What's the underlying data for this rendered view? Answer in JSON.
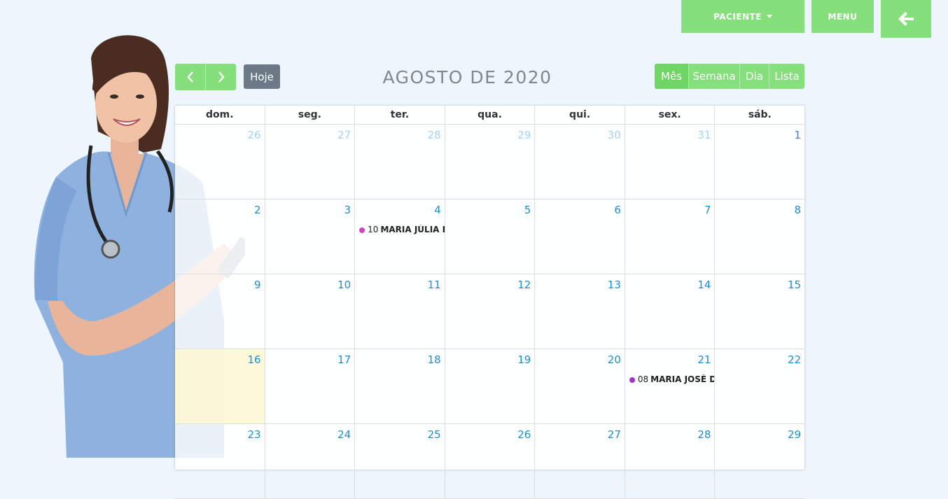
{
  "nav": {
    "paciente_label": "PACIENTE",
    "menu_label": "MENU"
  },
  "toolbar": {
    "today_label": "Hoje",
    "title": "AGOSTO DE 2020",
    "views": [
      "Mês",
      "Semana",
      "Dia",
      "Lista"
    ],
    "active_view": "Mês"
  },
  "colors": {
    "accent": "#85e07c",
    "today_button": "#6c7a88",
    "day_number": "#1f8fd6",
    "today_highlight": "#fcf8d2"
  },
  "calendar": {
    "weekdays": [
      "dom.",
      "seg.",
      "ter.",
      "qua.",
      "qui.",
      "sex.",
      "sáb."
    ],
    "weeks": [
      [
        {
          "d": "26",
          "other": true
        },
        {
          "d": "27",
          "other": true
        },
        {
          "d": "28",
          "other": true
        },
        {
          "d": "29",
          "other": true
        },
        {
          "d": "30",
          "other": true
        },
        {
          "d": "31",
          "other": true
        },
        {
          "d": "1"
        }
      ],
      [
        {
          "d": "2"
        },
        {
          "d": "3"
        },
        {
          "d": "4",
          "event": {
            "time": "10",
            "title": "MARIA JÚLIA D",
            "color": "#d63fc6"
          }
        },
        {
          "d": "5"
        },
        {
          "d": "6"
        },
        {
          "d": "7"
        },
        {
          "d": "8"
        }
      ],
      [
        {
          "d": "9"
        },
        {
          "d": "10"
        },
        {
          "d": "11"
        },
        {
          "d": "12"
        },
        {
          "d": "13"
        },
        {
          "d": "14"
        },
        {
          "d": "15"
        }
      ],
      [
        {
          "d": "16",
          "today": true
        },
        {
          "d": "17"
        },
        {
          "d": "18"
        },
        {
          "d": "19"
        },
        {
          "d": "20"
        },
        {
          "d": "21",
          "event": {
            "time": "08",
            "title": "MARIA JOSÉ DA",
            "color": "#9b36c9"
          }
        },
        {
          "d": "22"
        }
      ],
      [
        {
          "d": "23"
        },
        {
          "d": "24"
        },
        {
          "d": "25"
        },
        {
          "d": "26"
        },
        {
          "d": "27"
        },
        {
          "d": "28"
        },
        {
          "d": "29"
        }
      ]
    ]
  }
}
